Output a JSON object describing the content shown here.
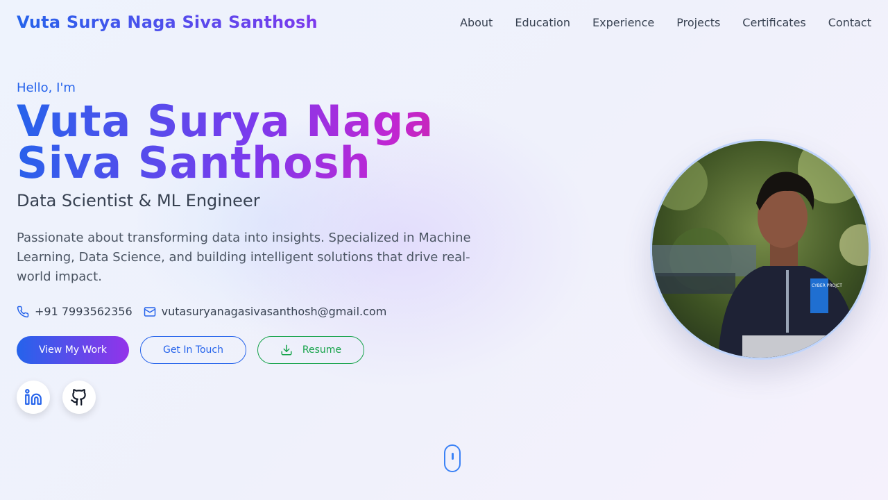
{
  "header": {
    "logo": "Vuta Surya Naga Siva Santhosh",
    "nav": [
      "About",
      "Education",
      "Experience",
      "Projects",
      "Certificates",
      "Contact"
    ]
  },
  "hero": {
    "greeting": "Hello, I'm",
    "name": "Vuta Surya Naga Siva Santhosh",
    "role": "Data Scientist & ML Engineer",
    "bio": "Passionate about transforming data into insights. Specialized in Machine Learning, Data Science, and building intelligent solutions that drive real-world impact.",
    "phone": "+91 7993562356",
    "email": "vutasuryanagasivasanthosh@gmail.com",
    "buttons": {
      "view_work": "View My Work",
      "get_in_touch": "Get In Touch",
      "resume": "Resume"
    },
    "socials": [
      {
        "icon": "linkedin-icon"
      },
      {
        "icon": "github-icon"
      }
    ],
    "photo_badge": "CYBER PROJCT"
  },
  "colors": {
    "accent_blue": "#2563eb",
    "accent_purple": "#7c3aed",
    "accent_pink": "#db2777",
    "accent_green": "#16a34a"
  }
}
